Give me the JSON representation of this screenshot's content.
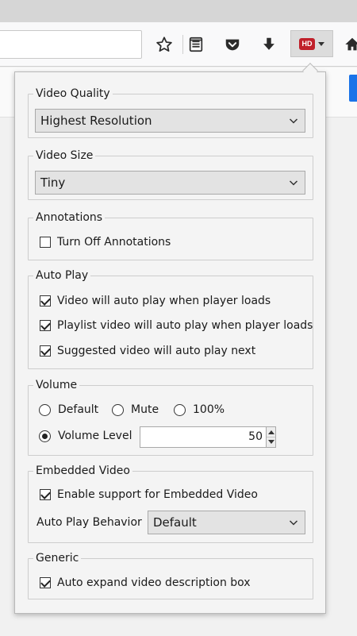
{
  "toolbar": {
    "icons": [
      "star-icon",
      "reader-icon",
      "pocket-icon",
      "download-icon",
      "hd-extension-icon",
      "home-icon"
    ],
    "hd_logo_text": "HD"
  },
  "panel": {
    "video_quality": {
      "legend": "Video Quality",
      "selected": "Highest Resolution"
    },
    "video_size": {
      "legend": "Video Size",
      "selected": "Tiny"
    },
    "annotations": {
      "legend": "Annotations",
      "turn_off_label": "Turn Off Annotations",
      "turn_off_checked": false
    },
    "auto_play": {
      "legend": "Auto Play",
      "items": [
        {
          "label": "Video will auto play when player loads",
          "checked": true
        },
        {
          "label": "Playlist video will auto play when player loads",
          "checked": true
        },
        {
          "label": "Suggested video will auto play next",
          "checked": true
        }
      ]
    },
    "volume": {
      "legend": "Volume",
      "options": [
        {
          "label": "Default",
          "selected": false
        },
        {
          "label": "Mute",
          "selected": false
        },
        {
          "label": "100%",
          "selected": false
        },
        {
          "label": "Volume Level",
          "selected": true
        }
      ],
      "level_value": "50"
    },
    "embedded": {
      "legend": "Embedded Video",
      "enable_label": "Enable support for Embedded Video",
      "enable_checked": true,
      "behavior_label": "Auto Play Behavior",
      "behavior_selected": "Default"
    },
    "generic": {
      "legend": "Generic",
      "expand_label": "Auto expand video description box",
      "expand_checked": true
    }
  }
}
